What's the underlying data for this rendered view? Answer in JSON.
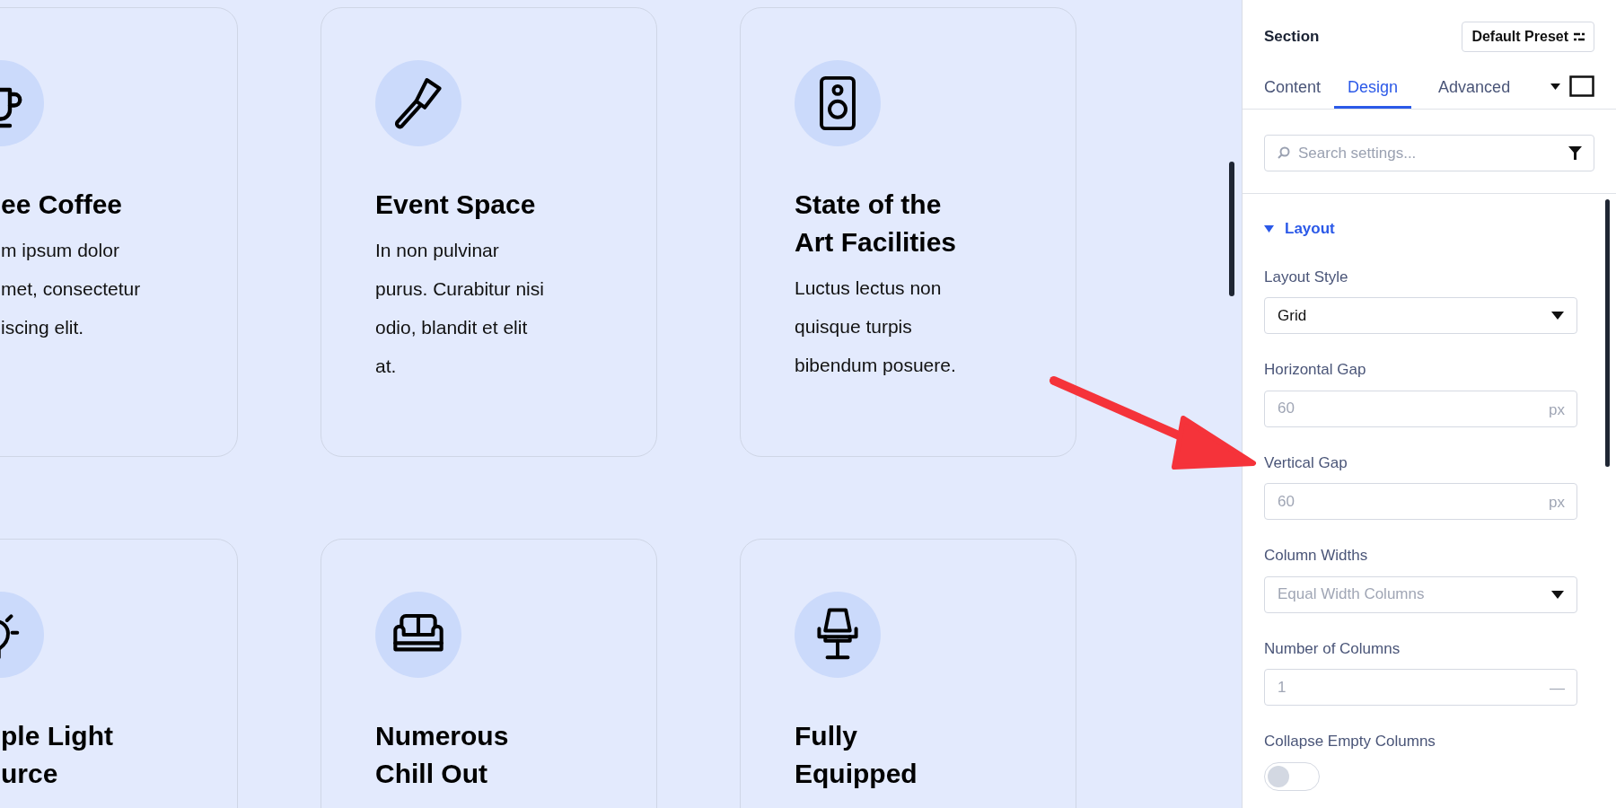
{
  "cards": [
    {
      "title": [
        "ee Coffee"
      ],
      "body": [
        "m ipsum dolor",
        "met, consectetur",
        "iscing elit."
      ]
    },
    {
      "title": [
        "Event Space"
      ],
      "body": [
        "In non pulvinar",
        "purus. Curabitur nisi",
        "odio, blandit et elit",
        "at."
      ]
    },
    {
      "title": [
        "State of the",
        "Art Facilities"
      ],
      "body": [
        "Luctus lectus non",
        "quisque turpis",
        "bibendum posuere."
      ]
    },
    {
      "title": [
        "ple Light",
        "urce"
      ]
    },
    {
      "title": [
        "Numerous",
        "Chill Out"
      ]
    },
    {
      "title": [
        "Fully",
        "Equipped"
      ]
    }
  ],
  "panel": {
    "title": "Section",
    "preset_button": "Default Preset",
    "tabs": [
      {
        "label": "Content",
        "selected": false
      },
      {
        "label": "Design",
        "selected": true
      },
      {
        "label": "Advanced",
        "selected": false
      }
    ],
    "search": {
      "placeholder": "Search settings..."
    },
    "group": {
      "label": "Layout",
      "expanded": true
    },
    "settings": [
      {
        "kind": "select",
        "label": "Layout Style",
        "value": "Grid"
      },
      {
        "kind": "unit",
        "label": "Horizontal Gap",
        "placeholder": "60",
        "unit": "px"
      },
      {
        "kind": "unit",
        "label": "Vertical Gap",
        "placeholder": "60",
        "unit": "px"
      },
      {
        "kind": "select",
        "label": "Column Widths",
        "placeholder": "Equal Width Columns"
      },
      {
        "kind": "number",
        "label": "Number of Columns",
        "placeholder": "1",
        "suffix": "—"
      },
      {
        "kind": "toggle",
        "label": "Collapse Empty Columns",
        "on": false
      }
    ]
  }
}
